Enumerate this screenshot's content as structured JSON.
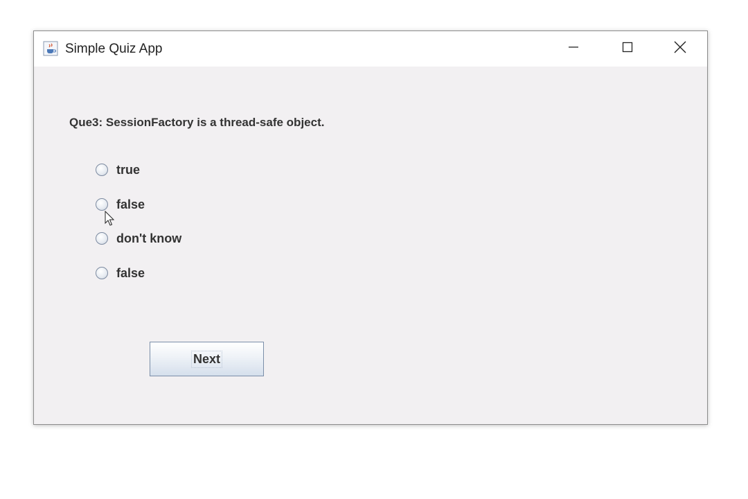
{
  "window": {
    "title": "Simple Quiz App",
    "icon": "java-cup-icon"
  },
  "controls": {
    "minimize_icon": "minimize-icon",
    "maximize_icon": "maximize-icon",
    "close_icon": "close-icon"
  },
  "quiz": {
    "question": "Que3: SessionFactory is a thread-safe object.",
    "options": [
      {
        "label": "true",
        "selected": false
      },
      {
        "label": "false",
        "selected": false
      },
      {
        "label": "don't know",
        "selected": false
      },
      {
        "label": "false",
        "selected": false
      }
    ],
    "next_label": "Next"
  },
  "colors": {
    "background": "#f2f0f2",
    "titlebar": "#ffffff",
    "text": "#333333"
  }
}
